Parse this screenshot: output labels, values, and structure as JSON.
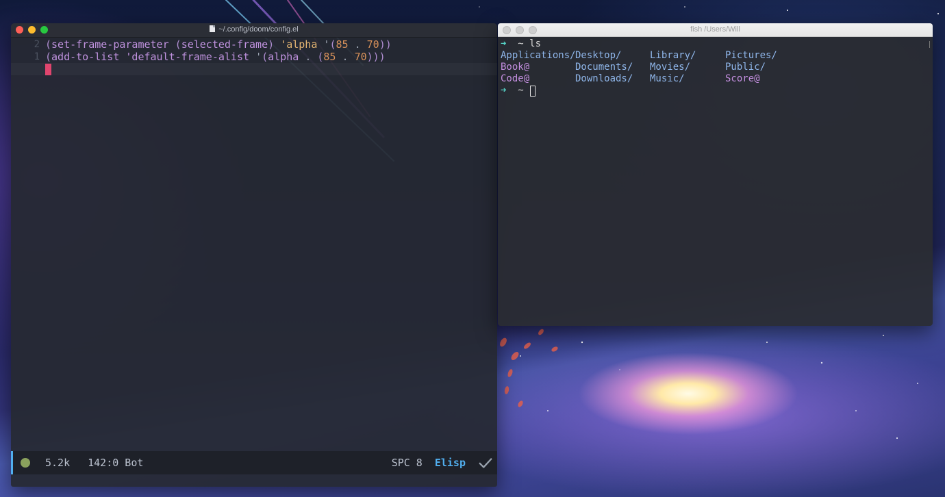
{
  "emacs": {
    "title": "~/.config/doom/config.el",
    "lines": [
      {
        "num": "2",
        "text": "(set-frame-parameter (selected-frame) 'alpha '(85 . 70))"
      },
      {
        "num": "1",
        "text": "(add-to-list 'default-frame-alist '(alpha . (85 . 70)))"
      },
      {
        "num": "",
        "text": ""
      }
    ],
    "modeline": {
      "size": "5.2k",
      "position": "142:0 Bot",
      "indent": "SPC 8",
      "mode": "Elisp",
      "status_icon": "checkmark-icon"
    }
  },
  "terminal": {
    "title": "fish /Users/Will",
    "prompt_symbol": "➜",
    "prompt_dir": "~",
    "command": "ls",
    "listing": [
      [
        "Applications/",
        "Desktop/",
        "Library/",
        "Pictures/"
      ],
      [
        "Book@",
        "Documents/",
        "Movies/",
        "Public/"
      ],
      [
        "Code@",
        "Downloads/",
        "Music/",
        "Score@"
      ]
    ]
  },
  "colors": {
    "accent": "#51afef",
    "cursor": "#e0456e",
    "prompt": "#56d4c8",
    "directory": "#8fb6ea",
    "symlink": "#c48fe0"
  }
}
